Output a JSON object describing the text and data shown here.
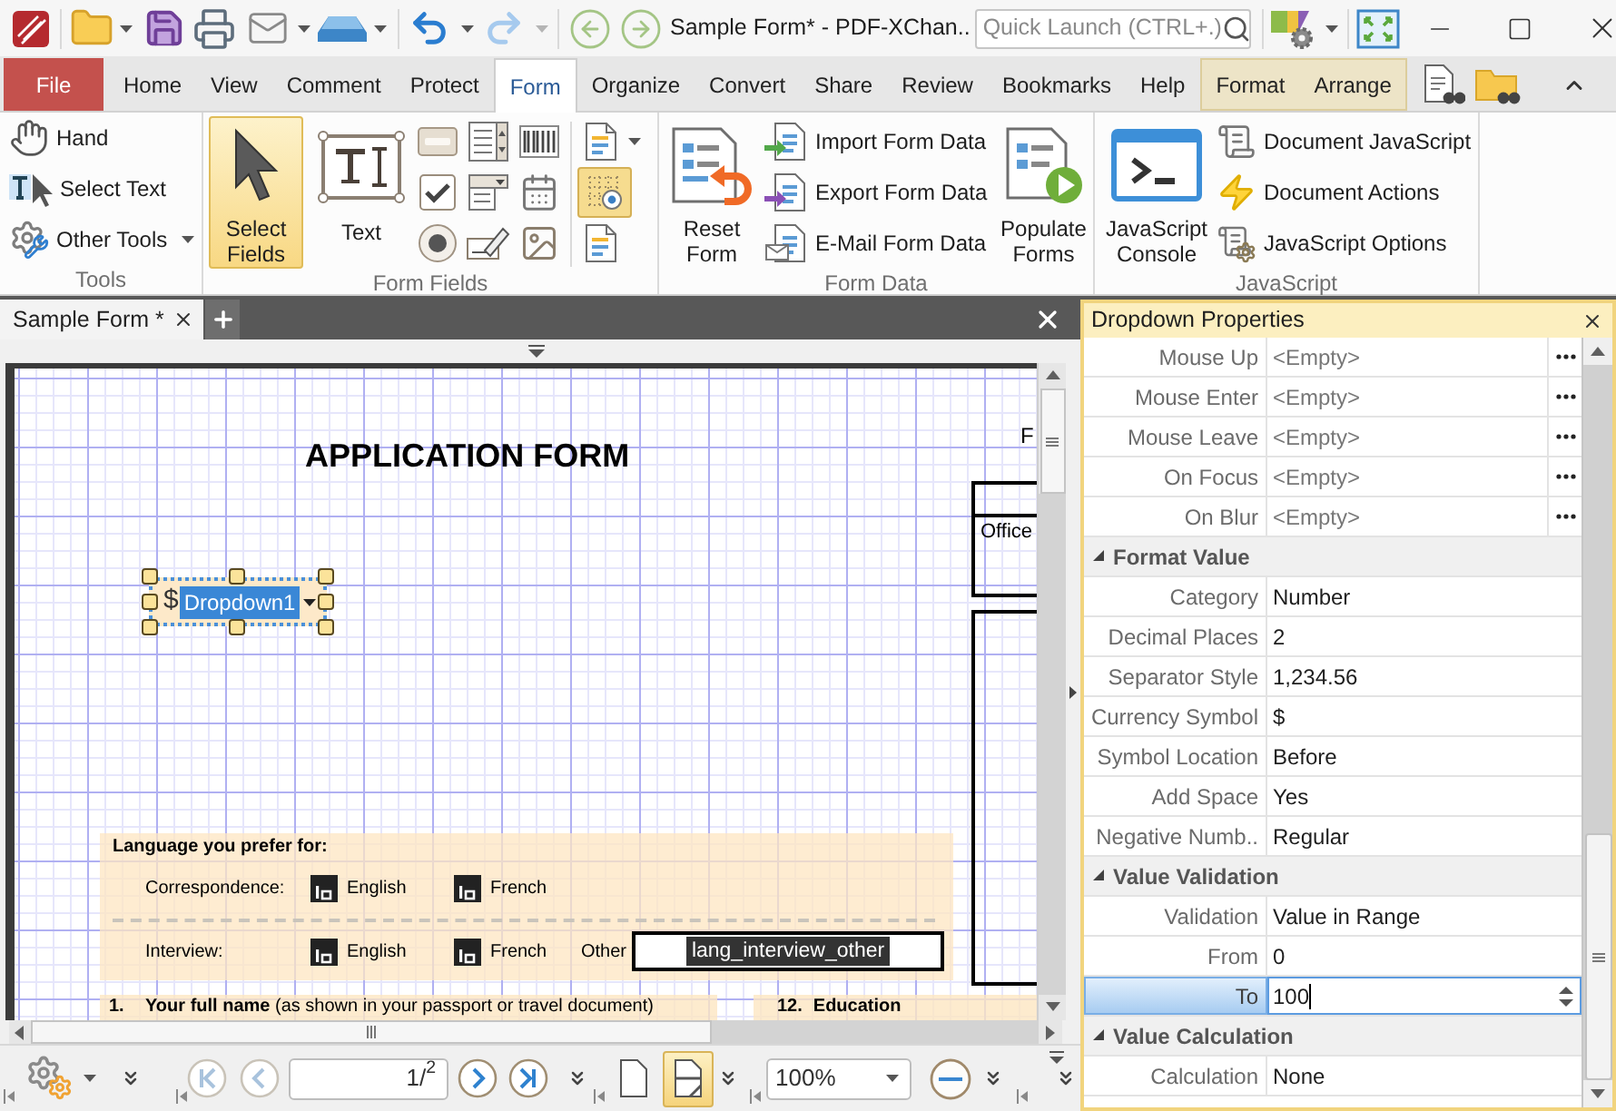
{
  "window": {
    "title": "Sample Form* - PDF-XChan..",
    "search": {
      "placeholder": "Quick Launch (CTRL+.)"
    }
  },
  "menu_tabs": [
    {
      "label": "File",
      "kind": "file",
      "selected": false
    },
    {
      "label": "Home",
      "kind": "tab",
      "selected": false
    },
    {
      "label": "View",
      "kind": "tab",
      "selected": false
    },
    {
      "label": "Comment",
      "kind": "tab",
      "selected": false
    },
    {
      "label": "Protect",
      "kind": "tab",
      "selected": false
    },
    {
      "label": "Form",
      "kind": "tab",
      "selected": true
    },
    {
      "label": "Organize",
      "kind": "tab",
      "selected": false
    },
    {
      "label": "Convert",
      "kind": "tab",
      "selected": false
    },
    {
      "label": "Share",
      "kind": "tab",
      "selected": false
    },
    {
      "label": "Review",
      "kind": "tab",
      "selected": false
    },
    {
      "label": "Bookmarks",
      "kind": "tab",
      "selected": false
    },
    {
      "label": "Help",
      "kind": "tab",
      "selected": false
    },
    {
      "label": "Format",
      "kind": "context",
      "selected": false
    },
    {
      "label": "Arrange",
      "kind": "context",
      "selected": false
    }
  ],
  "ribbon": {
    "tools": {
      "title": "Tools",
      "buttons": [
        "Hand",
        "Select Text",
        "Other Tools"
      ]
    },
    "form_fields": {
      "title": "Form Fields",
      "large_buttons": [
        {
          "label": "Select Fields",
          "selected": true
        },
        {
          "label": "Text",
          "selected": false
        }
      ],
      "toggle": {
        "on": true
      }
    },
    "form_data": {
      "title": "Form Data",
      "large_buttons": [
        "Reset Form",
        "Populate Forms"
      ],
      "buttons": [
        "Import Form Data",
        "Export Form Data",
        "E-Mail Form Data"
      ]
    },
    "javascript": {
      "title": "JavaScript",
      "large_buttons": [
        "JavaScript Console"
      ],
      "buttons": [
        "Document JavaScript",
        "Document Actions",
        "JavaScript Options"
      ]
    }
  },
  "document": {
    "tabs": [
      {
        "label": "Sample Form *",
        "selected": true
      }
    ],
    "page": {
      "title": "APPLICATION FORM",
      "edge_text": "F",
      "office_label": "Office",
      "dropdown_field": {
        "prefix": "$",
        "value": "Dropdown1",
        "selected": true
      },
      "language": {
        "heading": "Language you prefer for:",
        "rows": [
          {
            "label": "Correspondence:",
            "options": [
              "English",
              "French"
            ]
          },
          {
            "label": "Interview:",
            "options": [
              "English",
              "French"
            ],
            "other": {
              "label": "Other",
              "value": "lang_interview_other"
            }
          }
        ]
      },
      "questions": [
        {
          "kind": "question",
          "number": "1.",
          "text": "**Your full name** (as shown in your passport or travel document)"
        },
        {
          "kind": "heading",
          "number": "12.",
          "text": "Education"
        }
      ]
    },
    "toolbar": {
      "nav_buttons": [
        {
          "kind": "first",
          "disabled": true
        },
        {
          "kind": "previous",
          "disabled": true
        },
        {
          "kind": "next",
          "disabled": false
        },
        {
          "kind": "last",
          "disabled": false
        }
      ],
      "page_field": "1/$^{2}$",
      "layout_buttons": [
        {
          "kind": "page",
          "selected": false
        },
        {
          "kind": "page_split",
          "selected": true
        }
      ],
      "zoom": "100%"
    }
  },
  "properties": {
    "title": "Dropdown Properties",
    "rows": [
      {
        "kind": "action",
        "label": "Mouse Up",
        "value": "<Empty>",
        "selected": false
      },
      {
        "kind": "action",
        "label": "Mouse Enter",
        "value": "<Empty>",
        "selected": false
      },
      {
        "kind": "action",
        "label": "Mouse Leave",
        "value": "<Empty>",
        "selected": false
      },
      {
        "kind": "action",
        "label": "On Focus",
        "value": "<Empty>",
        "selected": false
      },
      {
        "kind": "action",
        "label": "On Blur",
        "value": "<Empty>",
        "selected": false
      },
      {
        "kind": "section",
        "label": "Format Value",
        "expanded": true,
        "selected": false
      },
      {
        "kind": "value",
        "label": "Category",
        "value": "Number",
        "selected": false
      },
      {
        "kind": "value",
        "label": "Decimal Places",
        "value": "2",
        "selected": false
      },
      {
        "kind": "value",
        "label": "Separator Style",
        "value": "1,234.56",
        "selected": false
      },
      {
        "kind": "value",
        "label": "Currency Symbol",
        "value": "$",
        "selected": false
      },
      {
        "kind": "value",
        "label": "Symbol Location",
        "value": "Before",
        "selected": false
      },
      {
        "kind": "value",
        "label": "Add Space",
        "value": "Yes",
        "selected": false
      },
      {
        "kind": "value",
        "label": "Negative Numb..",
        "value": "Regular",
        "selected": false
      },
      {
        "kind": "section",
        "label": "Value Validation",
        "expanded": true,
        "selected": false
      },
      {
        "kind": "value",
        "label": "Validation",
        "value": "Value in Range",
        "selected": false
      },
      {
        "kind": "value",
        "label": "From",
        "value": "0",
        "selected": false
      },
      {
        "kind": "spin",
        "label": "To",
        "value": "100",
        "selected": true
      },
      {
        "kind": "section",
        "label": "Value Calculation",
        "expanded": true,
        "selected": false
      },
      {
        "kind": "value",
        "label": "Calculation",
        "value": "None",
        "selected": false
      }
    ]
  }
}
